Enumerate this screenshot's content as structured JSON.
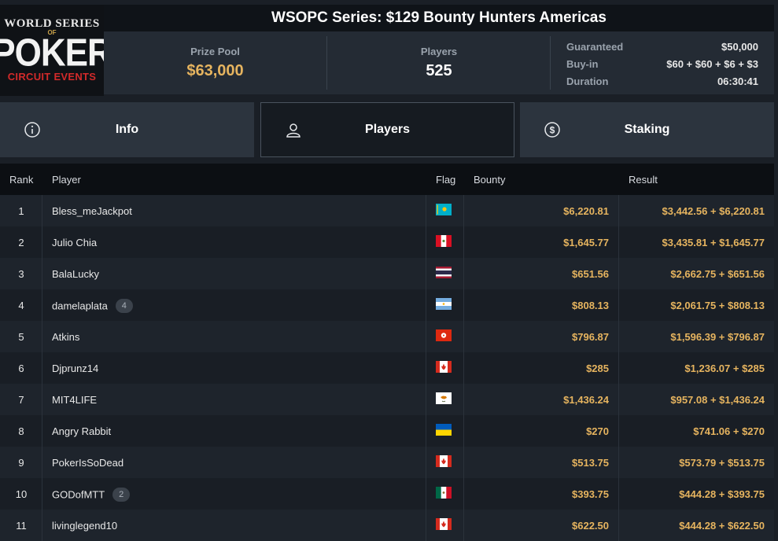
{
  "header": {
    "logo_line1": "WORLD SERIES",
    "logo_of": "OF",
    "logo_line2": "POKER",
    "logo_line3": "CIRCUIT EVENTS",
    "title": "WSOPC Series: $129 Bounty Hunters Americas",
    "prize_pool_label": "Prize Pool",
    "prize_pool_value": "$63,000",
    "players_label": "Players",
    "players_value": "525",
    "details": [
      {
        "key": "Guaranteed",
        "value": "$50,000"
      },
      {
        "key": "Buy-in",
        "value": "$60 + $60 + $6 + $3"
      },
      {
        "key": "Duration",
        "value": "06:30:41"
      }
    ]
  },
  "tabs": [
    {
      "label": "Info",
      "icon": "info-icon",
      "active": false
    },
    {
      "label": "Players",
      "icon": "user-icon",
      "active": true
    },
    {
      "label": "Staking",
      "icon": "dollar-icon",
      "active": false
    }
  ],
  "table": {
    "headers": {
      "rank": "Rank",
      "player": "Player",
      "flag": "Flag",
      "bounty": "Bounty",
      "result": "Result"
    },
    "rows": [
      {
        "rank": "1",
        "player": "Bless_meJackpot",
        "badge": "",
        "flag": "kazakhstan",
        "bounty": "$6,220.81",
        "result": "$3,442.56 + $6,220.81"
      },
      {
        "rank": "2",
        "player": "Julio Chia",
        "badge": "",
        "flag": "peru",
        "bounty": "$1,645.77",
        "result": "$3,435.81 + $1,645.77"
      },
      {
        "rank": "3",
        "player": "BalaLucky",
        "badge": "",
        "flag": "thailand",
        "bounty": "$651.56",
        "result": "$2,662.75 + $651.56"
      },
      {
        "rank": "4",
        "player": "damelaplata",
        "badge": "4",
        "flag": "argentina",
        "bounty": "$808.13",
        "result": "$2,061.75 + $808.13"
      },
      {
        "rank": "5",
        "player": "Atkins",
        "badge": "",
        "flag": "hongkong",
        "bounty": "$796.87",
        "result": "$1,596.39 + $796.87"
      },
      {
        "rank": "6",
        "player": "Djprunz14",
        "badge": "",
        "flag": "canada",
        "bounty": "$285",
        "result": "$1,236.07 + $285"
      },
      {
        "rank": "7",
        "player": "MIT4LIFE",
        "badge": "",
        "flag": "cyprus",
        "bounty": "$1,436.24",
        "result": "$957.08 + $1,436.24"
      },
      {
        "rank": "8",
        "player": "Angry Rabbit",
        "badge": "",
        "flag": "ukraine",
        "bounty": "$270",
        "result": "$741.06 + $270"
      },
      {
        "rank": "9",
        "player": "PokerIsSoDead",
        "badge": "",
        "flag": "canada",
        "bounty": "$513.75",
        "result": "$573.79 + $513.75"
      },
      {
        "rank": "10",
        "player": "GODofMTT",
        "badge": "2",
        "flag": "mexico",
        "bounty": "$393.75",
        "result": "$444.28 + $393.75"
      },
      {
        "rank": "11",
        "player": "livinglegend10",
        "badge": "",
        "flag": "canada",
        "bounty": "$622.50",
        "result": "$444.28 + $622.50"
      }
    ]
  },
  "colors": {
    "accent_gold": "#e6b45f",
    "background": "#1a1f26",
    "logo_red": "#d32a2a"
  }
}
